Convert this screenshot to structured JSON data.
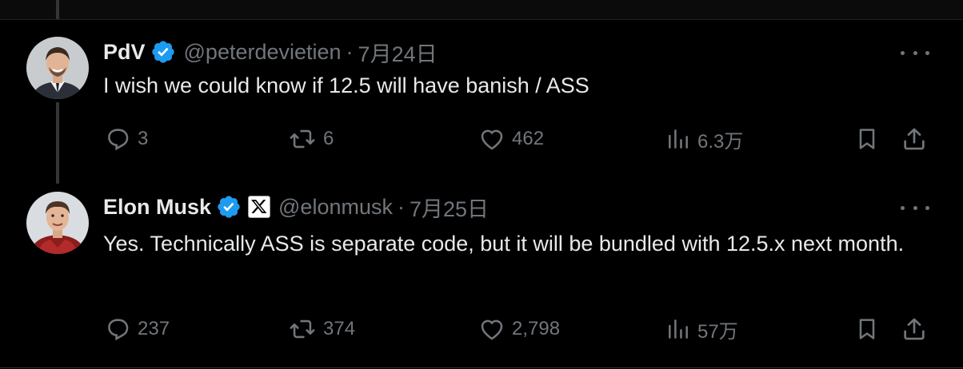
{
  "tweets": [
    {
      "display_name": "PdV",
      "handle": "@peterdevietien",
      "separator": "·",
      "date": "7月24日",
      "text": "I wish we could know if 12.5 will have banish / ASS",
      "verified": true,
      "affiliate_badge": false,
      "metrics": {
        "replies": "3",
        "reposts": "6",
        "likes": "462",
        "views": "6.3万"
      }
    },
    {
      "display_name": "Elon Musk",
      "handle": "@elonmusk",
      "separator": "·",
      "date": "7月25日",
      "text": "Yes. Technically ASS is separate code, but it will be bundled with 12.5.x next month.",
      "verified": true,
      "affiliate_badge": true,
      "metrics": {
        "replies": "237",
        "reposts": "374",
        "likes": "2,798",
        "views": "57万"
      }
    }
  ],
  "colors": {
    "background": "#000000",
    "text_primary": "#e7e9ea",
    "text_secondary": "#71767b",
    "verified_blue": "#1d9bf0",
    "divider": "#2f3336"
  },
  "icons": {
    "reply": "speech-bubble-icon",
    "repost": "repost-arrows-icon",
    "like": "heart-icon",
    "views": "bar-chart-icon",
    "bookmark": "bookmark-icon",
    "share": "share-upload-icon",
    "more": "more-dots-icon",
    "verified": "verified-badge-icon",
    "affiliate": "x-logo-icon"
  }
}
